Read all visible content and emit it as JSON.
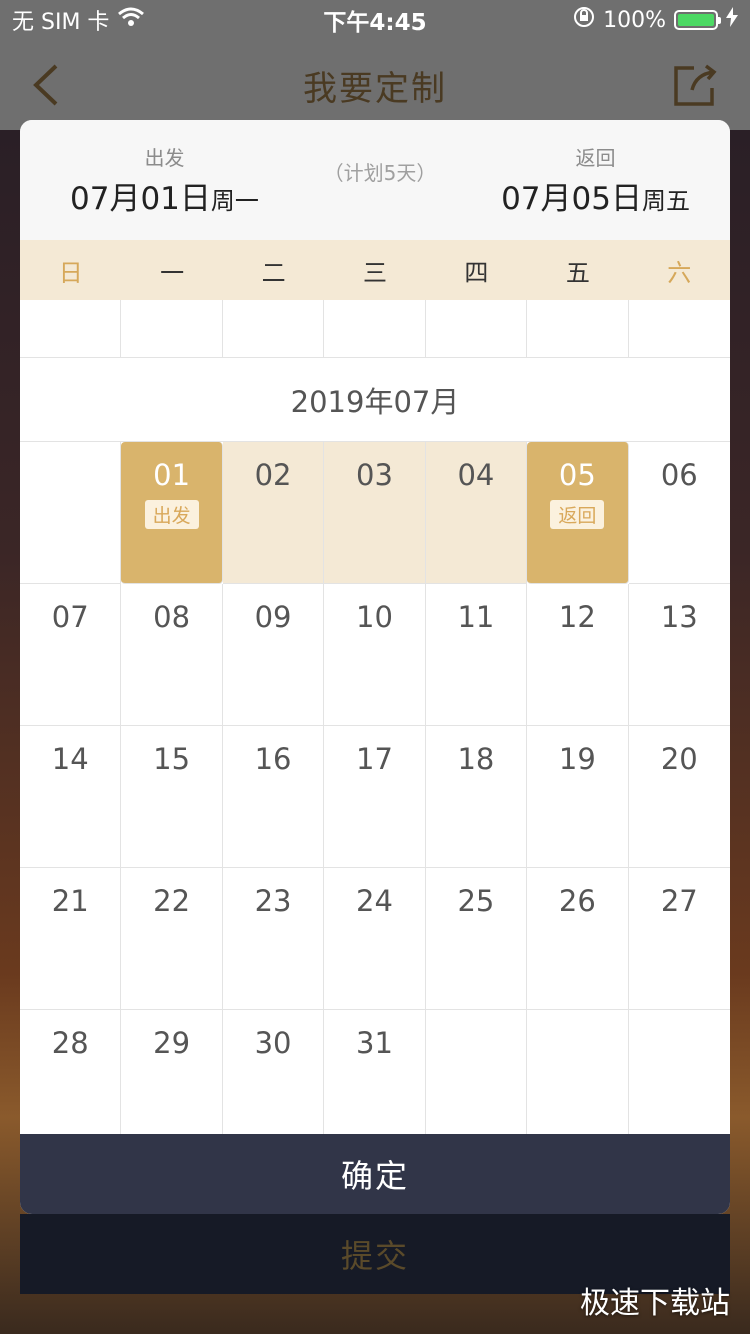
{
  "status": {
    "carrier": "无 SIM 卡",
    "time": "下午4:45",
    "battery": "100%"
  },
  "nav": {
    "title": "我要定制"
  },
  "range": {
    "depart_label": "出发",
    "depart_date": "07月01日",
    "depart_weekday": "周一",
    "plan": "（计划5天）",
    "return_label": "返回",
    "return_date": "07月05日",
    "return_weekday": "周五"
  },
  "weekdays": [
    "日",
    "一",
    "二",
    "三",
    "四",
    "五",
    "六"
  ],
  "month_title": "2019年07月",
  "days": [
    "",
    "01",
    "02",
    "03",
    "04",
    "05",
    "06",
    "07",
    "08",
    "09",
    "10",
    "11",
    "12",
    "13",
    "14",
    "15",
    "16",
    "17",
    "18",
    "19",
    "20",
    "21",
    "22",
    "23",
    "24",
    "25",
    "26",
    "27",
    "28",
    "29",
    "30",
    "31",
    "",
    "",
    ""
  ],
  "selection": {
    "start_tag": "出发",
    "end_tag": "返回"
  },
  "buttons": {
    "confirm": "确定",
    "submit": "提交"
  },
  "watermark": "极速下载站",
  "colors": {
    "accent": "#d9b46c",
    "range_bg": "#f4e9d5",
    "confirm_bg": "#313548"
  }
}
